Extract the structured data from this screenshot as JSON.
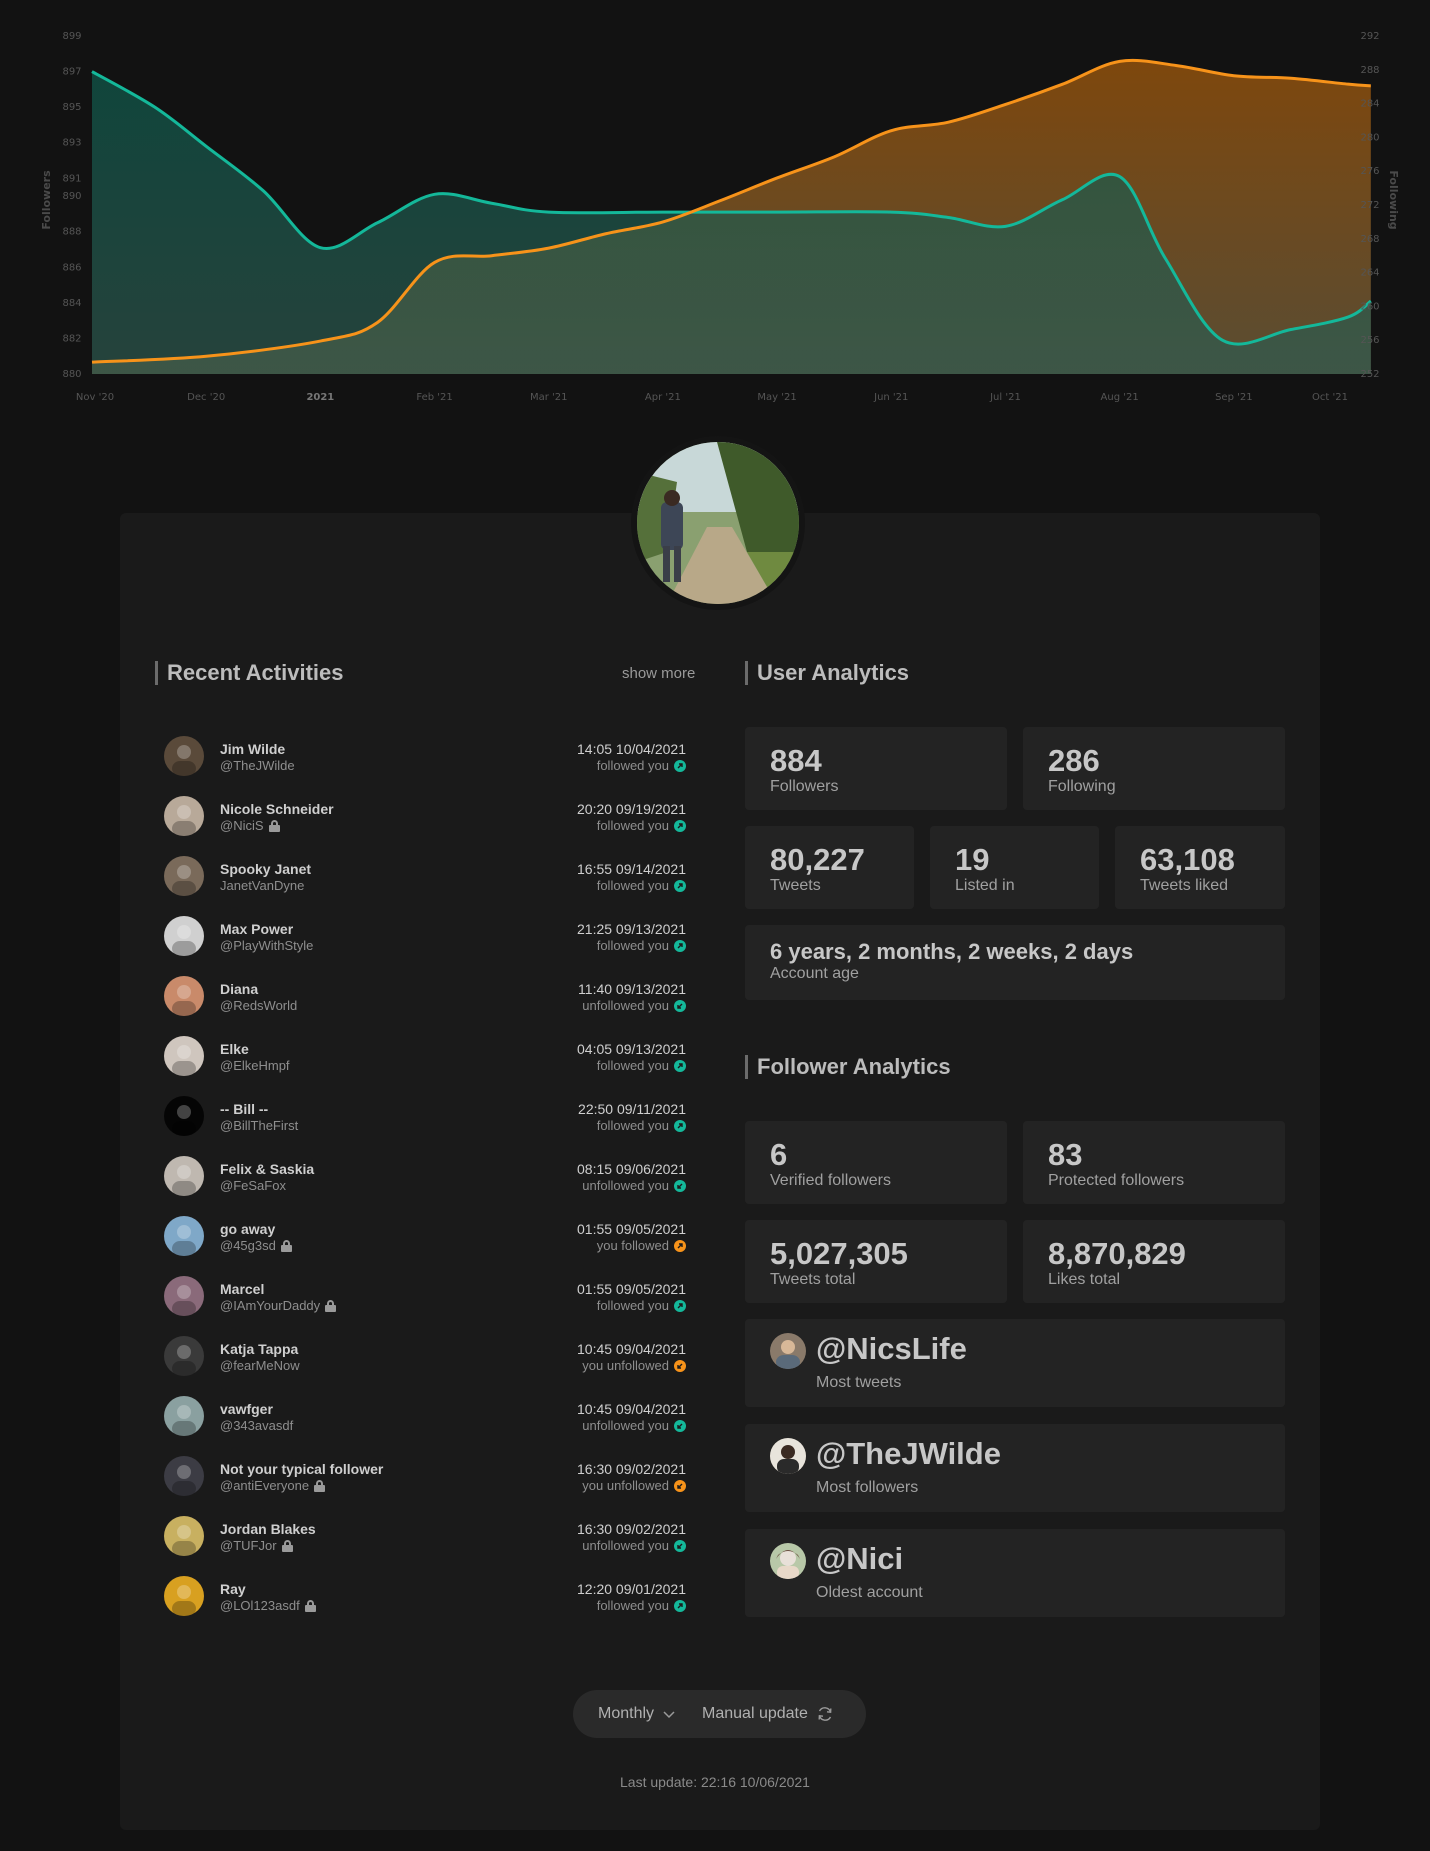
{
  "colors": {
    "teal": "#14b89a",
    "orange": "#f7931a",
    "background": "#121212",
    "card": "#1a1a1a",
    "box": "#232323"
  },
  "chart_data": {
    "type": "area",
    "x": [
      "Nov '20",
      "Dec '20",
      "2021",
      "Feb '21",
      "Mar '21",
      "Apr '21",
      "May '21",
      "Jun '21",
      "Jul '21",
      "Aug '21",
      "Sep '21",
      "Oct '21"
    ],
    "xlabel_bold": "2021",
    "series": [
      {
        "axis": "left",
        "color": "#14b89a",
        "points": [
          [
            0,
            897
          ],
          [
            0.55,
            895
          ],
          [
            1.0,
            892.8
          ],
          [
            1.5,
            890.3
          ],
          [
            2.0,
            887.1
          ],
          [
            2.5,
            888.5
          ],
          [
            3.0,
            890.1
          ],
          [
            3.5,
            889.6
          ],
          [
            4.0,
            889.1
          ],
          [
            5.0,
            889.1
          ],
          [
            6.0,
            889.1
          ],
          [
            7.0,
            889.1
          ],
          [
            7.5,
            888.8
          ],
          [
            8.0,
            888.3
          ],
          [
            8.5,
            889.8
          ],
          [
            9.0,
            891.1
          ],
          [
            9.4,
            886.5
          ],
          [
            9.9,
            881.9
          ],
          [
            10.5,
            882.5
          ],
          [
            11.0,
            883.2
          ],
          [
            11.2,
            884.1
          ]
        ]
      },
      {
        "axis": "right",
        "color": "#f7931a",
        "points": [
          [
            0,
            253.4
          ],
          [
            1.0,
            254.1
          ],
          [
            2.0,
            255.9
          ],
          [
            2.5,
            258.1
          ],
          [
            3.0,
            265.2
          ],
          [
            3.5,
            266.0
          ],
          [
            4.0,
            266.9
          ],
          [
            4.5,
            268.6
          ],
          [
            5.0,
            270.0
          ],
          [
            5.5,
            272.5
          ],
          [
            6.0,
            275.2
          ],
          [
            6.5,
            277.7
          ],
          [
            7.0,
            280.8
          ],
          [
            7.5,
            281.8
          ],
          [
            8.0,
            283.9
          ],
          [
            8.5,
            286.3
          ],
          [
            9.0,
            289.0
          ],
          [
            9.5,
            288.5
          ],
          [
            10.0,
            287.3
          ],
          [
            10.5,
            287.0
          ],
          [
            11.0,
            286.3
          ],
          [
            11.2,
            286.1
          ]
        ]
      }
    ],
    "y_left": {
      "label": "Followers",
      "ticks": [
        880,
        882,
        884,
        886,
        888,
        890,
        891,
        893,
        895,
        897,
        899
      ],
      "range": [
        880,
        899
      ]
    },
    "y_right": {
      "label": "Following",
      "ticks": [
        252,
        256,
        260,
        264,
        268,
        272,
        276,
        280,
        284,
        288,
        292
      ],
      "range": [
        252,
        292
      ]
    },
    "grid": false,
    "legend": "none"
  },
  "profile": {
    "avatar_icon": "profile-photo-path"
  },
  "recent": {
    "title": "Recent Activities",
    "show_more": "show more",
    "items": [
      {
        "name": "Jim Wilde",
        "handle": "@TheJWilde",
        "locked": false,
        "time": "14:05 10/04/2021",
        "status": "followed you",
        "type": "followed",
        "avatar_color": "#5a4a3a"
      },
      {
        "name": "Nicole Schneider",
        "handle": "@NiciS",
        "locked": true,
        "time": "20:20 09/19/2021",
        "status": "followed you",
        "type": "followed",
        "avatar_color": "#b8a999"
      },
      {
        "name": "Spooky Janet",
        "handle": "JanetVanDyne",
        "locked": false,
        "time": "16:55 09/14/2021",
        "status": "followed you",
        "type": "followed",
        "avatar_color": "#7a6a5a"
      },
      {
        "name": "Max Power",
        "handle": "@PlayWithStyle",
        "locked": false,
        "time": "21:25 09/13/2021",
        "status": "followed you",
        "type": "followed",
        "avatar_color": "#d0d0d0"
      },
      {
        "name": "Diana",
        "handle": "@RedsWorld",
        "locked": false,
        "time": "11:40 09/13/2021",
        "status": "unfollowed you",
        "type": "unfollowed",
        "avatar_color": "#c98a6a"
      },
      {
        "name": "Elke",
        "handle": "@ElkeHmpf",
        "locked": false,
        "time": "04:05 09/13/2021",
        "status": "followed you",
        "type": "followed",
        "avatar_color": "#cfc6be"
      },
      {
        "name": "-- Bill --",
        "handle": "@BillTheFirst",
        "locked": false,
        "time": "22:50 09/11/2021",
        "status": "followed you",
        "type": "followed",
        "avatar_color": "#050505"
      },
      {
        "name": "Felix & Saskia",
        "handle": "@FeSaFox",
        "locked": false,
        "time": "08:15 09/06/2021",
        "status": "unfollowed you",
        "type": "unfollowed",
        "avatar_color": "#bfb8b0"
      },
      {
        "name": "go away",
        "handle": "@45g3sd",
        "locked": true,
        "time": "01:55 09/05/2021",
        "status": "you followed",
        "type": "you-followed",
        "avatar_color": "#7fa8c8"
      },
      {
        "name": "Marcel",
        "handle": "@IAmYourDaddy",
        "locked": true,
        "time": "01:55 09/05/2021",
        "status": "followed you",
        "type": "followed",
        "avatar_color": "#8a6a7a"
      },
      {
        "name": "Katja Tappa",
        "handle": "@fearMeNow",
        "locked": false,
        "time": "10:45 09/04/2021",
        "status": "you unfollowed",
        "type": "you-unfollowed",
        "avatar_color": "#3a3a3a"
      },
      {
        "name": "vawfger",
        "handle": "@343avasdf",
        "locked": false,
        "time": "10:45 09/04/2021",
        "status": "unfollowed you",
        "type": "unfollowed",
        "avatar_color": "#8aa0a0"
      },
      {
        "name": "Not your typical follower",
        "handle": "@antiEveryone",
        "locked": true,
        "time": "16:30 09/02/2021",
        "status": "you unfollowed",
        "type": "you-unfollowed",
        "avatar_color": "#3c3c44"
      },
      {
        "name": "Jordan Blakes",
        "handle": "@TUFJor",
        "locked": true,
        "time": "16:30 09/02/2021",
        "status": "unfollowed you",
        "type": "unfollowed",
        "avatar_color": "#c8b060"
      },
      {
        "name": "Ray",
        "handle": "@LOl123asdf",
        "locked": true,
        "time": "12:20 09/01/2021",
        "status": "followed you",
        "type": "followed",
        "avatar_color": "#d8a020"
      }
    ]
  },
  "user_analytics": {
    "title": "User Analytics",
    "followers": {
      "value": "884",
      "label": "Followers"
    },
    "following": {
      "value": "286",
      "label": "Following"
    },
    "tweets": {
      "value": "80,227",
      "label": "Tweets"
    },
    "listed": {
      "value": "19",
      "label": "Listed in"
    },
    "liked": {
      "value": "63,108",
      "label": "Tweets liked"
    },
    "age": {
      "value": "6 years, 2 months, 2 weeks, 2 days",
      "label": "Account age"
    }
  },
  "follower_analytics": {
    "title": "Follower Analytics",
    "verified": {
      "value": "6",
      "label": "Verified followers"
    },
    "protected": {
      "value": "83",
      "label": "Protected followers"
    },
    "tweets_total": {
      "value": "5,027,305",
      "label": "Tweets total"
    },
    "likes_total": {
      "value": "8,870,829",
      "label": "Likes total"
    },
    "most_tweets": {
      "handle": "@NicsLife",
      "label": "Most tweets",
      "avatar_color": "#8a7a6a"
    },
    "most_followers": {
      "handle": "@TheJWilde",
      "label": "Most followers",
      "avatar_color": "#5a4a3a"
    },
    "oldest": {
      "handle": "@Nici",
      "label": "Oldest account",
      "avatar_color": "#b8c8a8"
    }
  },
  "controls": {
    "period": "Monthly",
    "period_icon": "chevron-down-icon",
    "update": "Manual update",
    "update_icon": "refresh-icon"
  },
  "last_update": "Last update: 22:16 10/06/2021"
}
